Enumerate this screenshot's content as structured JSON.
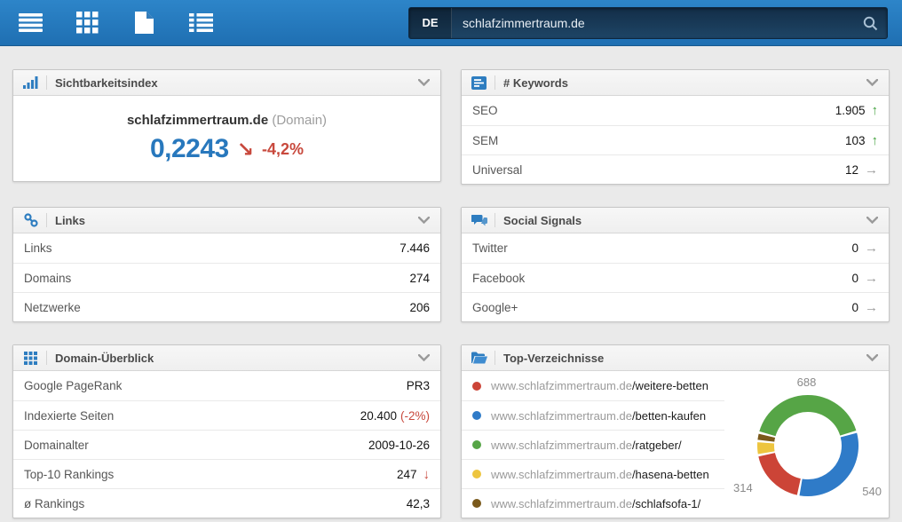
{
  "header": {
    "nav": [
      {
        "icon": "menu-icon"
      },
      {
        "icon": "apps-grid-icon"
      },
      {
        "icon": "document-icon"
      },
      {
        "icon": "list-icon"
      }
    ],
    "search": {
      "country_code": "DE",
      "value": "schlafzimmertraum.de",
      "icon": "search-icon"
    }
  },
  "colors": {
    "header_blue": "#2d85c9",
    "search_navy": "#132e48",
    "accent_blue": "#2878bd",
    "negative_red": "#c8493d",
    "positive_green": "#3fa03a",
    "neutral_gray": "#9a9a9a"
  },
  "widgets": {
    "visibility": {
      "title": "Sichtbarkeitsindex",
      "icon": "bar-chart-icon",
      "domain": "schlafzimmertraum.de",
      "domain_type": "(Domain)",
      "value": "0,2243",
      "trend": "down",
      "change": "-4,2%"
    },
    "keywords": {
      "title": "# Keywords",
      "icon": "keyword-list-icon",
      "rows": [
        {
          "label": "SEO",
          "value": "1.905",
          "trend": "up"
        },
        {
          "label": "SEM",
          "value": "103",
          "trend": "up"
        },
        {
          "label": "Universal",
          "value": "12",
          "trend": "right"
        }
      ]
    },
    "links": {
      "title": "Links",
      "icon": "link-icon",
      "rows": [
        {
          "label": "Links",
          "value": "7.446"
        },
        {
          "label": "Domains",
          "value": "274"
        },
        {
          "label": "Netzwerke",
          "value": "206"
        }
      ]
    },
    "social": {
      "title": "Social Signals",
      "icon": "chat-bubbles-icon",
      "rows": [
        {
          "label": "Twitter",
          "value": "0",
          "trend": "right"
        },
        {
          "label": "Facebook",
          "value": "0",
          "trend": "right"
        },
        {
          "label": "Google+",
          "value": "0",
          "trend": "right"
        }
      ]
    },
    "domain_overview": {
      "title": "Domain-Überblick",
      "icon": "grid-icon",
      "rows": [
        {
          "label": "Google PageRank",
          "value": "PR3"
        },
        {
          "label": "Indexierte Seiten",
          "value": "20.400",
          "extra": "(-2%)"
        },
        {
          "label": "Domainalter",
          "value": "2009-10-26"
        },
        {
          "label": "Top-10 Rankings",
          "value": "247",
          "trend": "down"
        },
        {
          "label": "ø Rankings",
          "value": "42,3"
        }
      ]
    },
    "top_directories": {
      "title": "Top-Verzeichnisse",
      "icon": "folder-open-icon",
      "rows": [
        {
          "color": "#cc4437",
          "domain": "www.schlafzimmertraum.de",
          "path": "/weitere-betten"
        },
        {
          "color": "#2f7bc8",
          "domain": "www.schlafzimmertraum.de",
          "path": "/betten-kaufen"
        },
        {
          "color": "#56a546",
          "domain": "www.schlafzimmertraum.de",
          "path": "/ratgeber/"
        },
        {
          "color": "#edc53f",
          "domain": "www.schlafzimmertraum.de",
          "path": "/hasena-betten"
        },
        {
          "color": "#7a591b",
          "domain": "www.schlafzimmertraum.de",
          "path": "/schlafsofa-1/"
        }
      ],
      "chart_data": {
        "type": "pie",
        "subtype": "donut",
        "title": "Top-Verzeichnisse",
        "legend_position": "left-list",
        "start_angle": 285,
        "segments": [
          {
            "color": "#56a546",
            "value": 688,
            "label": "688"
          },
          {
            "color": "#2f7bc8",
            "value": 540,
            "label": "540"
          },
          {
            "color": "#cc4437",
            "value": 314,
            "label": "314"
          },
          {
            "color": "#edc53f",
            "value": 75,
            "label": "",
            "estimated": true
          },
          {
            "color": "#7a591b",
            "value": 45,
            "label": "",
            "estimated": true
          }
        ],
        "labels": {
          "top": "688",
          "bottom_right": "540",
          "bottom_left": "314"
        }
      }
    }
  }
}
